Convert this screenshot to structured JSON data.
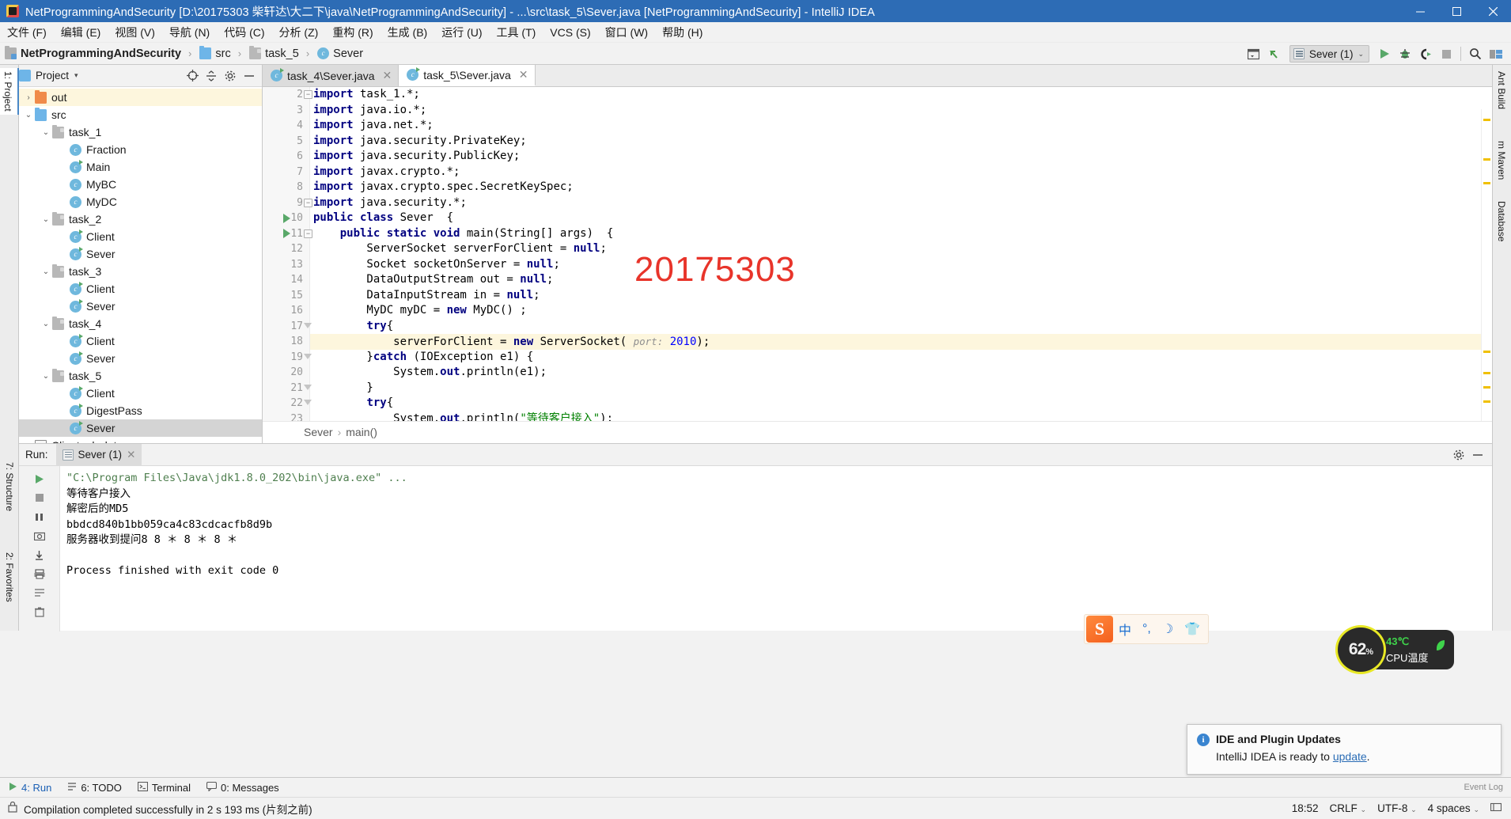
{
  "window": {
    "title": "NetProgrammingAndSecurity [D:\\20175303 柴轩达\\大二下\\java\\NetProgrammingAndSecurity] - ...\\src\\task_5\\Sever.java [NetProgrammingAndSecurity] - IntelliJ IDEA",
    "minimize": "—",
    "maximize": "□",
    "close": "✕"
  },
  "menubar": {
    "items": [
      {
        "label": "文件 (F)"
      },
      {
        "label": "编辑 (E)"
      },
      {
        "label": "视图 (V)"
      },
      {
        "label": "导航 (N)"
      },
      {
        "label": "代码 (C)"
      },
      {
        "label": "分析 (Z)"
      },
      {
        "label": "重构 (R)"
      },
      {
        "label": "生成 (B)"
      },
      {
        "label": "运行 (U)"
      },
      {
        "label": "工具 (T)"
      },
      {
        "label": "VCS (S)"
      },
      {
        "label": "窗口 (W)"
      },
      {
        "label": "帮助 (H)"
      }
    ]
  },
  "navbar": {
    "breadcrumbs": [
      {
        "label": "NetProgrammingAndSecurity",
        "icon": "module-folder-icon"
      },
      {
        "label": "src",
        "icon": "source-folder-icon"
      },
      {
        "label": "task_5",
        "icon": "package-folder-icon"
      },
      {
        "label": "Sever",
        "icon": "java-class-icon"
      }
    ],
    "separator": "›",
    "run_config": "Sever (1)",
    "dropdown_caret": "⌄"
  },
  "left_strip": {
    "tabs": [
      {
        "label": "1: Project"
      },
      {
        "label": "7: Structure"
      },
      {
        "label": "2: Favorites"
      }
    ]
  },
  "right_strip": {
    "tabs": [
      {
        "label": "Ant Build"
      },
      {
        "label": "m Maven"
      },
      {
        "label": "Database"
      }
    ]
  },
  "project_panel": {
    "title": "Project",
    "caret": "▾",
    "tree": [
      {
        "label": "out",
        "depth": 1,
        "arrow": "›",
        "icon": "folder-orange-icon",
        "state": "highlight"
      },
      {
        "label": "src",
        "depth": 1,
        "arrow": "⌄",
        "icon": "folder-blue-icon",
        "state": "none"
      },
      {
        "label": "task_1",
        "depth": 2,
        "arrow": "⌄",
        "icon": "folder-package-icon",
        "state": "none"
      },
      {
        "label": "Fraction",
        "depth": 3,
        "arrow": "",
        "icon": "java-class-icon",
        "state": "none"
      },
      {
        "label": "Main",
        "depth": 3,
        "arrow": "",
        "icon": "java-class-runnable-icon",
        "state": "none"
      },
      {
        "label": "MyBC",
        "depth": 3,
        "arrow": "",
        "icon": "java-class-icon",
        "state": "none"
      },
      {
        "label": "MyDC",
        "depth": 3,
        "arrow": "",
        "icon": "java-class-icon",
        "state": "none"
      },
      {
        "label": "task_2",
        "depth": 2,
        "arrow": "⌄",
        "icon": "folder-package-icon",
        "state": "none"
      },
      {
        "label": "Client",
        "depth": 3,
        "arrow": "",
        "icon": "java-class-runnable-icon",
        "state": "none"
      },
      {
        "label": "Sever",
        "depth": 3,
        "arrow": "",
        "icon": "java-class-runnable-icon",
        "state": "none"
      },
      {
        "label": "task_3",
        "depth": 2,
        "arrow": "⌄",
        "icon": "folder-package-icon",
        "state": "none"
      },
      {
        "label": "Client",
        "depth": 3,
        "arrow": "",
        "icon": "java-class-runnable-icon",
        "state": "none"
      },
      {
        "label": "Sever",
        "depth": 3,
        "arrow": "",
        "icon": "java-class-runnable-icon",
        "state": "none"
      },
      {
        "label": "task_4",
        "depth": 2,
        "arrow": "⌄",
        "icon": "folder-package-icon",
        "state": "none"
      },
      {
        "label": "Client",
        "depth": 3,
        "arrow": "",
        "icon": "java-class-runnable-icon",
        "state": "none"
      },
      {
        "label": "Sever",
        "depth": 3,
        "arrow": "",
        "icon": "java-class-runnable-icon",
        "state": "none"
      },
      {
        "label": "task_5",
        "depth": 2,
        "arrow": "⌄",
        "icon": "folder-package-icon",
        "state": "none"
      },
      {
        "label": "Client",
        "depth": 3,
        "arrow": "",
        "icon": "java-class-runnable-icon",
        "state": "none"
      },
      {
        "label": "DigestPass",
        "depth": 3,
        "arrow": "",
        "icon": "java-class-runnable-icon",
        "state": "none"
      },
      {
        "label": "Sever",
        "depth": 3,
        "arrow": "",
        "icon": "java-class-runnable-icon",
        "state": "selected"
      },
      {
        "label": "Clientpub.dat",
        "depth": 1,
        "arrow": "",
        "icon": "data-file-icon",
        "state": "none"
      }
    ]
  },
  "editor": {
    "tabs": [
      {
        "label": "task_4\\Sever.java",
        "active": false,
        "close": "✕"
      },
      {
        "label": "task_5\\Sever.java",
        "active": true,
        "close": "✕"
      }
    ],
    "watermark": "20175303",
    "breadcrumb": [
      "Sever",
      "main()"
    ],
    "breadcrumb_sep": "›",
    "lines": [
      {
        "n": "2",
        "indent": 0,
        "fold": "minus",
        "run": false,
        "hl": false,
        "tokens": [
          {
            "t": "import",
            "c": "kw"
          },
          {
            "t": " task_1.*;",
            "c": ""
          }
        ]
      },
      {
        "n": "3",
        "indent": 0,
        "fold": "",
        "run": false,
        "hl": false,
        "tokens": [
          {
            "t": "import",
            "c": "kw"
          },
          {
            "t": " java.io.*;",
            "c": ""
          }
        ]
      },
      {
        "n": "4",
        "indent": 0,
        "fold": "",
        "run": false,
        "hl": false,
        "tokens": [
          {
            "t": "import",
            "c": "kw"
          },
          {
            "t": " java.net.*;",
            "c": ""
          }
        ]
      },
      {
        "n": "5",
        "indent": 0,
        "fold": "",
        "run": false,
        "hl": false,
        "tokens": [
          {
            "t": "import",
            "c": "kw"
          },
          {
            "t": " java.security.PrivateKey;",
            "c": ""
          }
        ]
      },
      {
        "n": "6",
        "indent": 0,
        "fold": "",
        "run": false,
        "hl": false,
        "tokens": [
          {
            "t": "import",
            "c": "kw"
          },
          {
            "t": " java.security.PublicKey;",
            "c": ""
          }
        ]
      },
      {
        "n": "7",
        "indent": 0,
        "fold": "",
        "run": false,
        "hl": false,
        "tokens": [
          {
            "t": "import",
            "c": "kw"
          },
          {
            "t": " javax.crypto.*;",
            "c": ""
          }
        ]
      },
      {
        "n": "8",
        "indent": 0,
        "fold": "",
        "run": false,
        "hl": false,
        "tokens": [
          {
            "t": "import",
            "c": "kw"
          },
          {
            "t": " javax.crypto.spec.SecretKeySpec;",
            "c": ""
          }
        ]
      },
      {
        "n": "9",
        "indent": 0,
        "fold": "minus",
        "run": false,
        "hl": false,
        "tokens": [
          {
            "t": "import",
            "c": "kw"
          },
          {
            "t": " java.security.*;",
            "c": ""
          }
        ]
      },
      {
        "n": "10",
        "indent": 0,
        "fold": "",
        "run": true,
        "hl": false,
        "tokens": [
          {
            "t": "public class",
            "c": "kw"
          },
          {
            "t": " Sever  {",
            "c": ""
          }
        ]
      },
      {
        "n": "11",
        "indent": 1,
        "fold": "minus",
        "run": true,
        "hl": false,
        "tokens": [
          {
            "t": "    ",
            "c": ""
          },
          {
            "t": "public static void",
            "c": "kw"
          },
          {
            "t": " main(String[] args)  {",
            "c": ""
          }
        ]
      },
      {
        "n": "12",
        "indent": 2,
        "fold": "",
        "run": false,
        "hl": false,
        "tokens": [
          {
            "t": "        ServerSocket serverForClient = ",
            "c": ""
          },
          {
            "t": "null",
            "c": "kw"
          },
          {
            "t": ";",
            "c": ""
          }
        ]
      },
      {
        "n": "13",
        "indent": 2,
        "fold": "",
        "run": false,
        "hl": false,
        "tokens": [
          {
            "t": "        Socket socketOnServer = ",
            "c": ""
          },
          {
            "t": "null",
            "c": "kw"
          },
          {
            "t": ";",
            "c": ""
          }
        ]
      },
      {
        "n": "14",
        "indent": 2,
        "fold": "",
        "run": false,
        "hl": false,
        "tokens": [
          {
            "t": "        DataOutputStream out = ",
            "c": ""
          },
          {
            "t": "null",
            "c": "kw"
          },
          {
            "t": ";",
            "c": ""
          }
        ]
      },
      {
        "n": "15",
        "indent": 2,
        "fold": "",
        "run": false,
        "hl": false,
        "tokens": [
          {
            "t": "        DataInputStream in = ",
            "c": ""
          },
          {
            "t": "null",
            "c": "kw"
          },
          {
            "t": ";",
            "c": ""
          }
        ]
      },
      {
        "n": "16",
        "indent": 2,
        "fold": "",
        "run": false,
        "hl": false,
        "tokens": [
          {
            "t": "        MyDC myDC = ",
            "c": ""
          },
          {
            "t": "new",
            "c": "kw"
          },
          {
            "t": " MyDC() ;",
            "c": ""
          }
        ]
      },
      {
        "n": "17",
        "indent": 2,
        "fold": "tri",
        "run": false,
        "hl": false,
        "tokens": [
          {
            "t": "        ",
            "c": ""
          },
          {
            "t": "try",
            "c": "kw"
          },
          {
            "t": "{",
            "c": ""
          }
        ]
      },
      {
        "n": "18",
        "indent": 3,
        "fold": "",
        "run": false,
        "hl": true,
        "tokens": [
          {
            "t": "            serverForClient = ",
            "c": ""
          },
          {
            "t": "new",
            "c": "kw"
          },
          {
            "t": " ServerSocket( ",
            "c": ""
          },
          {
            "t": "port:",
            "c": "hint"
          },
          {
            "t": " ",
            "c": ""
          },
          {
            "t": "2010",
            "c": "num"
          },
          {
            "t": ");",
            "c": ""
          }
        ]
      },
      {
        "n": "19",
        "indent": 2,
        "fold": "tri",
        "run": false,
        "hl": false,
        "tokens": [
          {
            "t": "        }",
            "c": ""
          },
          {
            "t": "catch",
            "c": "kw"
          },
          {
            "t": " (IOException e1) {",
            "c": ""
          }
        ]
      },
      {
        "n": "20",
        "indent": 3,
        "fold": "",
        "run": false,
        "hl": false,
        "tokens": [
          {
            "t": "            System.",
            "c": ""
          },
          {
            "t": "out",
            "c": "kw"
          },
          {
            "t": ".println(e1);",
            "c": ""
          }
        ]
      },
      {
        "n": "21",
        "indent": 2,
        "fold": "tri",
        "run": false,
        "hl": false,
        "tokens": [
          {
            "t": "        }",
            "c": ""
          }
        ]
      },
      {
        "n": "22",
        "indent": 2,
        "fold": "tri",
        "run": false,
        "hl": false,
        "tokens": [
          {
            "t": "        ",
            "c": ""
          },
          {
            "t": "try",
            "c": "kw"
          },
          {
            "t": "{",
            "c": ""
          }
        ]
      },
      {
        "n": "23",
        "indent": 3,
        "fold": "",
        "run": false,
        "hl": false,
        "tokens": [
          {
            "t": "            System.",
            "c": ""
          },
          {
            "t": "out",
            "c": "kw"
          },
          {
            "t": ".println(",
            "c": ""
          },
          {
            "t": "\"等待客户接入\"",
            "c": "str"
          },
          {
            "t": ");",
            "c": ""
          }
        ]
      }
    ]
  },
  "run_panel": {
    "label": "Run:",
    "tab": "Sever (1)",
    "tab_close": "✕",
    "settings_icon": "gear-icon",
    "minimize_icon": "minimize-icon",
    "console": [
      {
        "text": "\"C:\\Program Files\\Java\\jdk1.8.0_202\\bin\\java.exe\" ...",
        "cls": "cmdline"
      },
      {
        "text": "等待客户接入",
        "cls": ""
      },
      {
        "text": "解密后的MD5",
        "cls": ""
      },
      {
        "text": "bbdcd840b1bb059ca4c83cdcacfb8d9b",
        "cls": ""
      },
      {
        "text": "服务器收到提问8 8 ＊  8 ＊  8 ＊",
        "cls": ""
      },
      {
        "text": "",
        "cls": "blank"
      },
      {
        "text": "Process finished with exit code 0",
        "cls": ""
      }
    ]
  },
  "bottom_tabs": {
    "items": [
      {
        "label": "4: Run",
        "icon": "run-icon",
        "active": true
      },
      {
        "label": "6: TODO",
        "icon": "todo-icon",
        "active": false
      },
      {
        "label": "Terminal",
        "icon": "terminal-icon",
        "active": false
      },
      {
        "label": "0: Messages",
        "icon": "messages-icon",
        "active": false
      }
    ],
    "event_log": "Event Log"
  },
  "statusbar": {
    "message": "Compilation completed successfully in 2 s 193 ms (片刻之前)",
    "time": "18:52",
    "line_sep": "CRLF",
    "encoding": "UTF-8",
    "indent": "4 spaces",
    "caret": "⌄",
    "lock_icon": "lock-icon"
  },
  "notification": {
    "title": "IDE and Plugin Updates",
    "body_prefix": "IntelliJ IDEA is ready to ",
    "link": "update",
    "body_suffix": ".",
    "info_icon": "i"
  },
  "ime_bar": {
    "logo": "S",
    "items": [
      {
        "label": "中",
        "name": "chinese-mode-icon"
      },
      {
        "label": "°,",
        "name": "punctuation-icon"
      },
      {
        "label": "☽",
        "name": "moon-icon"
      },
      {
        "label": "👕",
        "name": "skin-icon"
      }
    ]
  },
  "cpu_widget": {
    "percent": "62",
    "percent_unit": "%",
    "temperature": "43℃",
    "label": "CPU温度"
  }
}
